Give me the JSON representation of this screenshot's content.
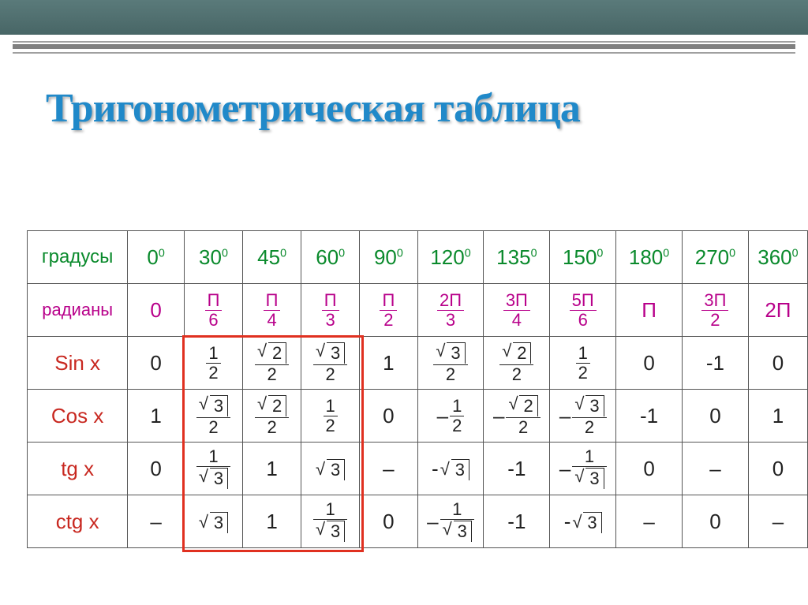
{
  "title": "Тригонометрическая таблица",
  "row_labels": {
    "degrees": "градусы",
    "radians": "радианы",
    "sin": "Sin x",
    "cos": "Cos x",
    "tg": "tg x",
    "ctg": "ctg x"
  },
  "degrees": [
    "0",
    "30",
    "45",
    "60",
    "90",
    "120",
    "135",
    "150",
    "180",
    "270",
    "360"
  ],
  "deg_sup": "0",
  "radians_disp": [
    {
      "t": "plain",
      "v": "0"
    },
    {
      "t": "frac",
      "n": "П",
      "d": "6"
    },
    {
      "t": "frac",
      "n": "П",
      "d": "4"
    },
    {
      "t": "frac",
      "n": "П",
      "d": "3"
    },
    {
      "t": "frac",
      "n": "П",
      "d": "2"
    },
    {
      "t": "frac",
      "n": "2П",
      "d": "3"
    },
    {
      "t": "frac",
      "n": "3П",
      "d": "4"
    },
    {
      "t": "frac",
      "n": "5П",
      "d": "6"
    },
    {
      "t": "plain",
      "v": "П"
    },
    {
      "t": "frac",
      "n": "3П",
      "d": "2"
    },
    {
      "t": "plain",
      "v": "2П"
    }
  ],
  "sin": [
    {
      "t": "plain",
      "v": "0"
    },
    {
      "t": "frac",
      "n": {
        "t": "plain",
        "v": "1"
      },
      "d": "2"
    },
    {
      "t": "frac",
      "n": {
        "t": "sqrt",
        "v": "2"
      },
      "d": "2"
    },
    {
      "t": "frac",
      "n": {
        "t": "sqrt",
        "v": "3"
      },
      "d": "2"
    },
    {
      "t": "plain",
      "v": "1"
    },
    {
      "t": "frac",
      "n": {
        "t": "sqrt",
        "v": "3"
      },
      "d": "2"
    },
    {
      "t": "frac",
      "n": {
        "t": "sqrt",
        "v": "2"
      },
      "d": "2"
    },
    {
      "t": "frac",
      "n": {
        "t": "plain",
        "v": "1"
      },
      "d": "2"
    },
    {
      "t": "plain",
      "v": "0"
    },
    {
      "t": "plain",
      "v": "-1"
    },
    {
      "t": "plain",
      "v": "0"
    }
  ],
  "cos": [
    {
      "t": "plain",
      "v": "1"
    },
    {
      "t": "frac",
      "n": {
        "t": "sqrt",
        "v": "3"
      },
      "d": "2"
    },
    {
      "t": "frac",
      "n": {
        "t": "sqrt",
        "v": "2"
      },
      "d": "2"
    },
    {
      "t": "frac",
      "n": {
        "t": "plain",
        "v": "1"
      },
      "d": "2"
    },
    {
      "t": "plain",
      "v": "0"
    },
    {
      "t": "frac",
      "neg": true,
      "n": {
        "t": "plain",
        "v": "1"
      },
      "d": "2"
    },
    {
      "t": "frac",
      "neg": true,
      "n": {
        "t": "sqrt",
        "v": "2"
      },
      "d": "2"
    },
    {
      "t": "frac",
      "neg": true,
      "n": {
        "t": "sqrt",
        "v": "3"
      },
      "d": "2"
    },
    {
      "t": "plain",
      "v": "-1"
    },
    {
      "t": "plain",
      "v": "0"
    },
    {
      "t": "plain",
      "v": "1"
    }
  ],
  "tg": [
    {
      "t": "plain",
      "v": "0"
    },
    {
      "t": "frac",
      "n": {
        "t": "plain",
        "v": "1"
      },
      "d": {
        "t": "sqrt",
        "v": "3"
      }
    },
    {
      "t": "plain",
      "v": "1"
    },
    {
      "t": "sqrt",
      "v": "3"
    },
    {
      "t": "plain",
      "v": "–"
    },
    {
      "t": "sqrt",
      "neg": true,
      "v": "3"
    },
    {
      "t": "plain",
      "v": "-1"
    },
    {
      "t": "frac",
      "neg": true,
      "n": {
        "t": "plain",
        "v": "1"
      },
      "d": {
        "t": "sqrt",
        "v": "3"
      }
    },
    {
      "t": "plain",
      "v": "0"
    },
    {
      "t": "plain",
      "v": "–"
    },
    {
      "t": "plain",
      "v": "0"
    }
  ],
  "ctg": [
    {
      "t": "plain",
      "v": "–"
    },
    {
      "t": "sqrt",
      "v": "3"
    },
    {
      "t": "plain",
      "v": "1"
    },
    {
      "t": "frac",
      "n": {
        "t": "plain",
        "v": "1"
      },
      "d": {
        "t": "sqrt",
        "v": "3"
      }
    },
    {
      "t": "plain",
      "v": "0"
    },
    {
      "t": "frac",
      "neg": true,
      "n": {
        "t": "plain",
        "v": "1"
      },
      "d": {
        "t": "sqrt",
        "v": "3"
      }
    },
    {
      "t": "plain",
      "v": "-1"
    },
    {
      "t": "sqrt",
      "neg": true,
      "v": "3"
    },
    {
      "t": "plain",
      "v": "–"
    },
    {
      "t": "plain",
      "v": "0"
    },
    {
      "t": "plain",
      "v": "–"
    }
  ],
  "highlight": {
    "row_start": 2,
    "row_end": 5,
    "col_start": 2,
    "col_end": 4
  },
  "chart_data": {
    "type": "table",
    "title": "Тригонометрическая таблица",
    "columns_degrees": [
      0,
      30,
      45,
      60,
      90,
      120,
      135,
      150,
      180,
      270,
      360
    ],
    "columns_radians": [
      "0",
      "π/6",
      "π/4",
      "π/3",
      "π/2",
      "2π/3",
      "3π/4",
      "5π/6",
      "π",
      "3π/2",
      "2π"
    ],
    "rows": {
      "sin": [
        "0",
        "1/2",
        "√2/2",
        "√3/2",
        "1",
        "√3/2",
        "√2/2",
        "1/2",
        "0",
        "-1",
        "0"
      ],
      "cos": [
        "1",
        "√3/2",
        "√2/2",
        "1/2",
        "0",
        "-1/2",
        "-√2/2",
        "-√3/2",
        "-1",
        "0",
        "1"
      ],
      "tg": [
        "0",
        "1/√3",
        "1",
        "√3",
        "—",
        "-√3",
        "-1",
        "-1/√3",
        "0",
        "—",
        "0"
      ],
      "ctg": [
        "—",
        "√3",
        "1",
        "1/√3",
        "0",
        "-1/√3",
        "-1",
        "-√3",
        "—",
        "0",
        "—"
      ]
    }
  }
}
